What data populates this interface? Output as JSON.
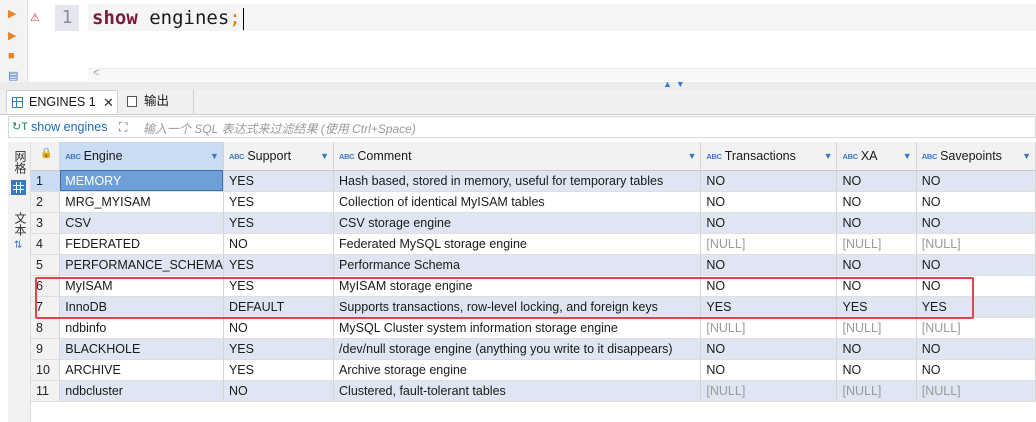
{
  "editor": {
    "line_number": "1",
    "keyword": "show",
    "rest": "engines",
    "semicolon": ";"
  },
  "tabs": [
    {
      "label": "ENGINES 1",
      "close": "✕"
    },
    {
      "label": "输出"
    }
  ],
  "filter": {
    "query_label": "show engines",
    "placeholder": "输入一个 SQL 表达式来过滤结果 (使用 Ctrl+Space)"
  },
  "side_panel": {
    "grid_label": "网格",
    "text_label": "文本"
  },
  "columns": [
    "Engine",
    "Support",
    "Comment",
    "Transactions",
    "XA",
    "Savepoints"
  ],
  "rows": [
    [
      "1",
      "MEMORY",
      "YES",
      "Hash based, stored in memory, useful for temporary tables",
      "NO",
      "NO",
      "NO"
    ],
    [
      "2",
      "MRG_MYISAM",
      "YES",
      "Collection of identical MyISAM tables",
      "NO",
      "NO",
      "NO"
    ],
    [
      "3",
      "CSV",
      "YES",
      "CSV storage engine",
      "NO",
      "NO",
      "NO"
    ],
    [
      "4",
      "FEDERATED",
      "NO",
      "Federated MySQL storage engine",
      "[NULL]",
      "[NULL]",
      "[NULL]"
    ],
    [
      "5",
      "PERFORMANCE_SCHEMA",
      "YES",
      "Performance Schema",
      "NO",
      "NO",
      "NO"
    ],
    [
      "6",
      "MyISAM",
      "YES",
      "MyISAM storage engine",
      "NO",
      "NO",
      "NO"
    ],
    [
      "7",
      "InnoDB",
      "DEFAULT",
      "Supports transactions, row-level locking, and foreign keys",
      "YES",
      "YES",
      "YES"
    ],
    [
      "8",
      "ndbinfo",
      "NO",
      "MySQL Cluster system information storage engine",
      "[NULL]",
      "[NULL]",
      "[NULL]"
    ],
    [
      "9",
      "BLACKHOLE",
      "YES",
      "/dev/null storage engine (anything you write to it disappears)",
      "NO",
      "NO",
      "NO"
    ],
    [
      "10",
      "ARCHIVE",
      "YES",
      "Archive storage engine",
      "NO",
      "NO",
      "NO"
    ],
    [
      "11",
      "ndbcluster",
      "NO",
      "Clustered, fault-tolerant tables",
      "[NULL]",
      "[NULL]",
      "[NULL]"
    ]
  ]
}
